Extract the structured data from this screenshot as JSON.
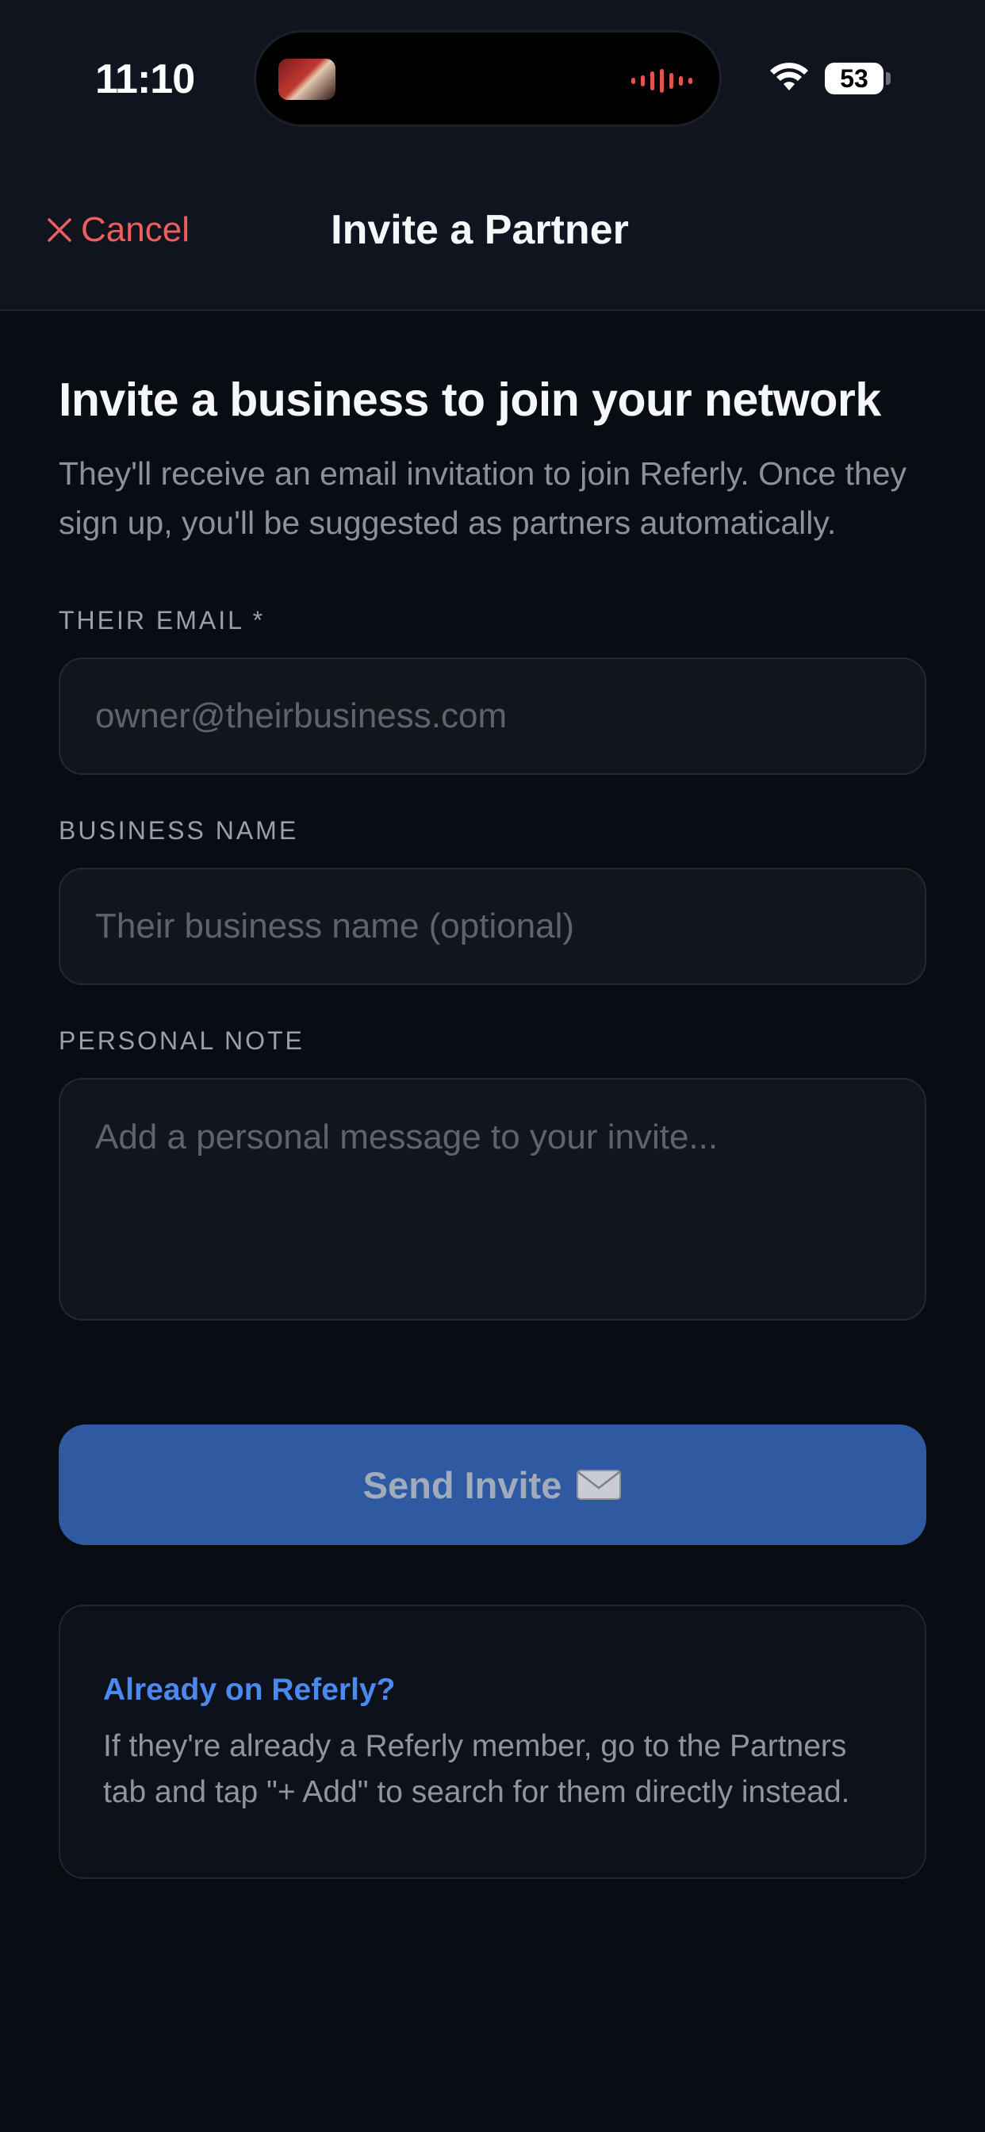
{
  "status_bar": {
    "time": "11:10",
    "battery": "53",
    "icons": [
      "now-playing-thumbnail",
      "audio-waveform-icon",
      "wifi-icon",
      "battery-icon"
    ]
  },
  "nav": {
    "cancel_label": "Cancel",
    "cancel_icon": "close-icon",
    "title": "Invite a Partner",
    "accent_color": "#ef5e5e"
  },
  "intro": {
    "headline": "Invite a business to join your network",
    "description": "They'll receive an email invitation to join Referly. Once they sign up, you'll be suggested as partners automatically."
  },
  "form": {
    "email": {
      "label": "THEIR EMAIL *",
      "placeholder": "owner@theirbusiness.com",
      "value": ""
    },
    "business_name": {
      "label": "BUSINESS NAME",
      "placeholder": "Their business name (optional)",
      "value": ""
    },
    "personal_note": {
      "label": "PERSONAL NOTE",
      "placeholder": "Add a personal message to your invite...",
      "value": ""
    }
  },
  "send_button": {
    "label": "Send Invite",
    "icon": "envelope-icon",
    "color": "#2f5aa2",
    "state": "disabled"
  },
  "info_card": {
    "title": "Already on Referly?",
    "body": "If they're already a Referly member, go to the Partners tab and tap \"+ Add\" to search for them directly instead.",
    "title_color": "#4a8af0"
  }
}
